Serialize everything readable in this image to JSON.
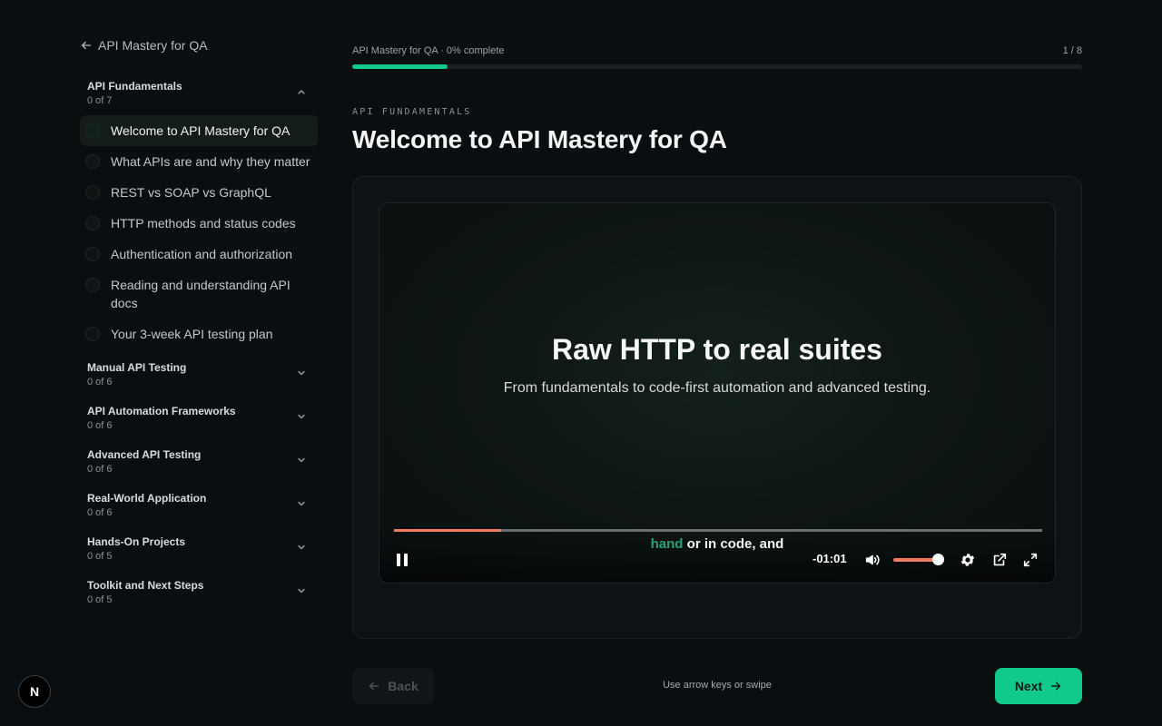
{
  "sidebar": {
    "back_label": "API Mastery for QA",
    "sections": [
      {
        "title": "API Fundamentals",
        "count": "0 of 7",
        "expanded": true,
        "lessons": [
          "Welcome to API Mastery for QA",
          "What APIs are and why they matter",
          "REST vs SOAP vs GraphQL",
          "HTTP methods and status codes",
          "Authentication and authorization",
          "Reading and understanding API docs",
          "Your 3-week API testing plan"
        ]
      },
      {
        "title": "Manual API Testing",
        "count": "0 of 6",
        "expanded": false
      },
      {
        "title": "API Automation Frameworks",
        "count": "0 of 6",
        "expanded": false
      },
      {
        "title": "Advanced API Testing",
        "count": "0 of 6",
        "expanded": false
      },
      {
        "title": "Real-World Application",
        "count": "0 of 6",
        "expanded": false
      },
      {
        "title": "Hands-On Projects",
        "count": "0 of 5",
        "expanded": false
      },
      {
        "title": "Toolkit and Next Steps",
        "count": "0 of 5",
        "expanded": false
      }
    ]
  },
  "progress": {
    "label": "API Mastery for QA · 0% complete",
    "step": "1 / 8",
    "fraction": 0.13
  },
  "lesson": {
    "eyebrow": "API FUNDAMENTALS",
    "title": "Welcome to API Mastery for QA"
  },
  "video": {
    "headline": "Raw HTTP to real suites",
    "subtitle": "From fundamentals to code-first automation and advanced testing.",
    "caption_highlight": "hand",
    "caption_rest": " or in code, and",
    "time_remaining": "-01:01",
    "playback_fraction": 0.165,
    "volume_fraction": 0.9
  },
  "footer": {
    "back_label": "Back",
    "hint": "Use arrow keys or swipe",
    "next_label": "Next"
  },
  "badge": {
    "letter": "N"
  },
  "colors": {
    "accent": "#10c98a",
    "video_progress": "#f27c61"
  }
}
